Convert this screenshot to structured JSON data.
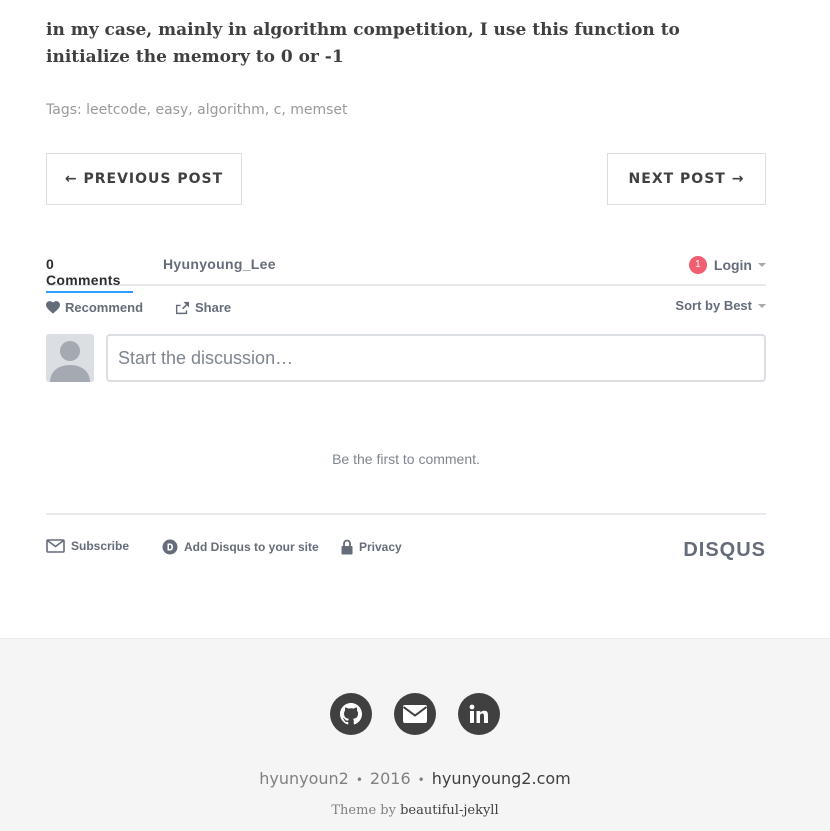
{
  "post": {
    "text": "in my case, mainly in algorithm competition, I use this function to initialize the memory to 0 or -1"
  },
  "tags": {
    "label": "Tags:",
    "items": [
      "leetcode",
      "easy",
      "algorithm",
      "c",
      "memset"
    ]
  },
  "pager": {
    "previous": "← PREVIOUS POST",
    "next": "NEXT POST →"
  },
  "disqus": {
    "comments_tab": "0 Comments",
    "user_tab": "Hyunyoung_Lee",
    "notification_count": "1",
    "login": "Login",
    "recommend": "Recommend",
    "share": "Share",
    "sort": "Sort by Best",
    "placeholder": "Start the discussion…",
    "empty": "Be the first to comment.",
    "subscribe": "Subscribe",
    "add_disqus": "Add Disqus to your site",
    "privacy": "Privacy",
    "logo": "DISQUS",
    "accent_color": "#2e9fff",
    "badge_color": "#f05f70"
  },
  "footer": {
    "social_icons": [
      "github-icon",
      "email-icon",
      "linkedin-icon"
    ],
    "author": "hyunyoun2",
    "year": "2016",
    "site": "hyunyoung2.com",
    "theme_prefix": "Theme by",
    "theme_name": "beautiful-jekyll"
  }
}
